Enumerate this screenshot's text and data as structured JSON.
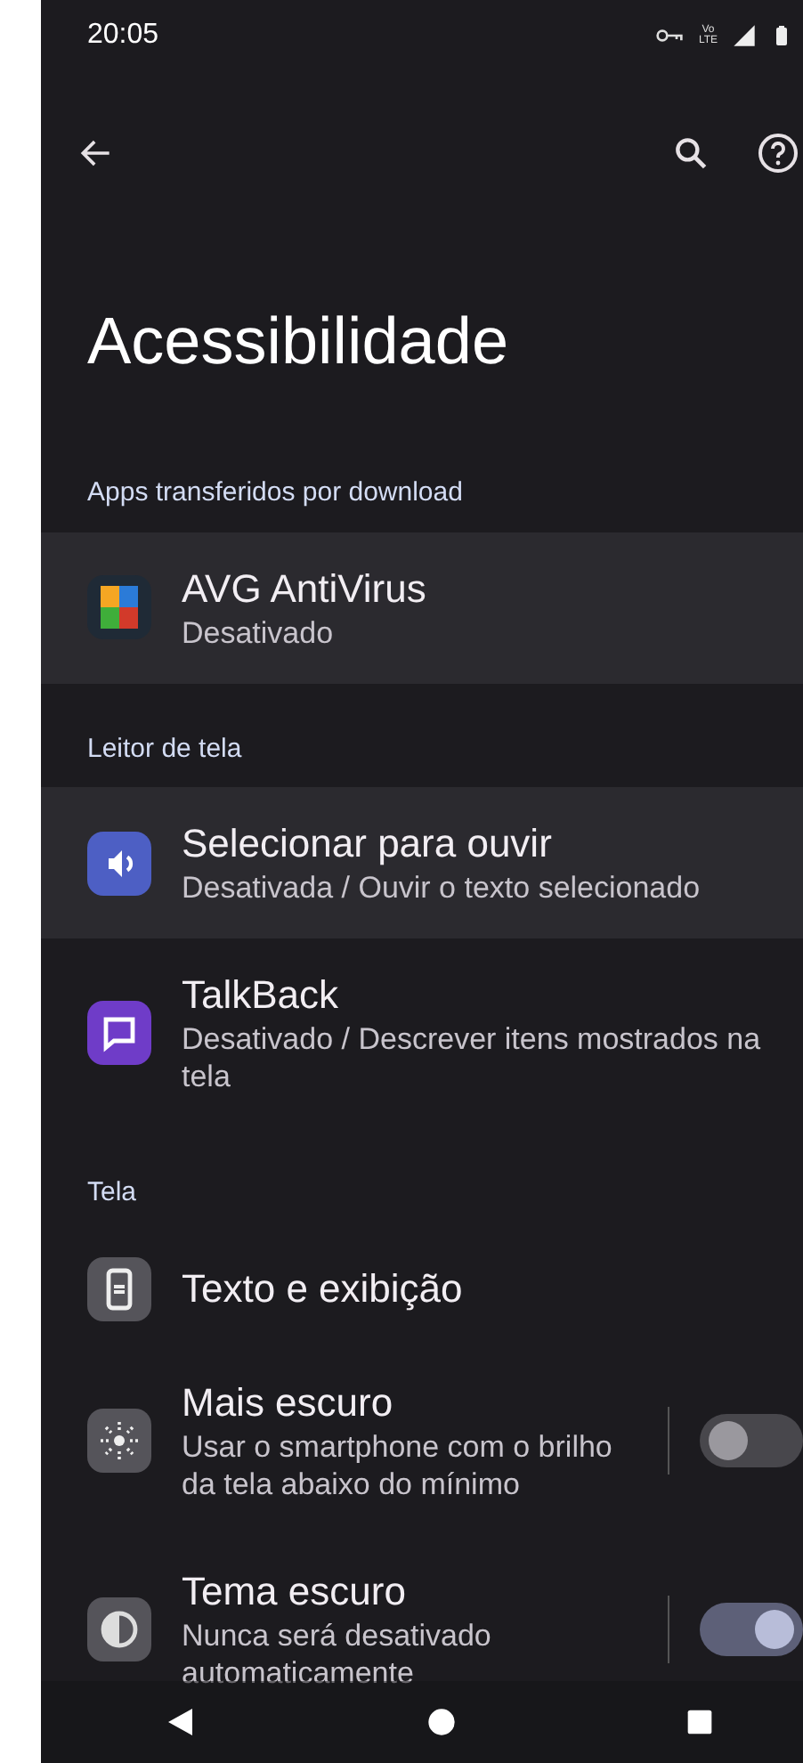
{
  "status_bar": {
    "time": "20:05",
    "network_top": "Vo",
    "network_bottom": "LTE"
  },
  "toolbar": {
    "title": "Acessibilidade"
  },
  "sections": [
    {
      "header": "Apps transferidos por download",
      "items": [
        {
          "kind": "app",
          "title": "AVG AntiVirus",
          "summary": "Desativado",
          "highlighted": true
        }
      ]
    },
    {
      "header": "Leitor de tela",
      "items": [
        {
          "kind": "app",
          "color": "#4d5fc4",
          "title": "Selecionar para ouvir",
          "summary": "Desativada / Ouvir o texto selecionado",
          "highlighted": true
        },
        {
          "kind": "app",
          "color": "#6f3cc8",
          "title": "TalkBack",
          "summary": "Desativado / Descrever itens mostrados na tela",
          "highlighted": false
        }
      ]
    },
    {
      "header": "Tela",
      "items": [
        {
          "kind": "nav",
          "title": "Texto e exibição",
          "highlighted": false
        },
        {
          "kind": "toggle",
          "title": "Mais escuro",
          "summary": "Usar o smartphone com o brilho da tela abaixo do mínimo",
          "on": false,
          "highlighted": false
        },
        {
          "kind": "toggle",
          "title": "Tema escuro",
          "summary": "Nunca será desativado automaticamente",
          "on": true,
          "highlighted": false
        }
      ]
    }
  ]
}
